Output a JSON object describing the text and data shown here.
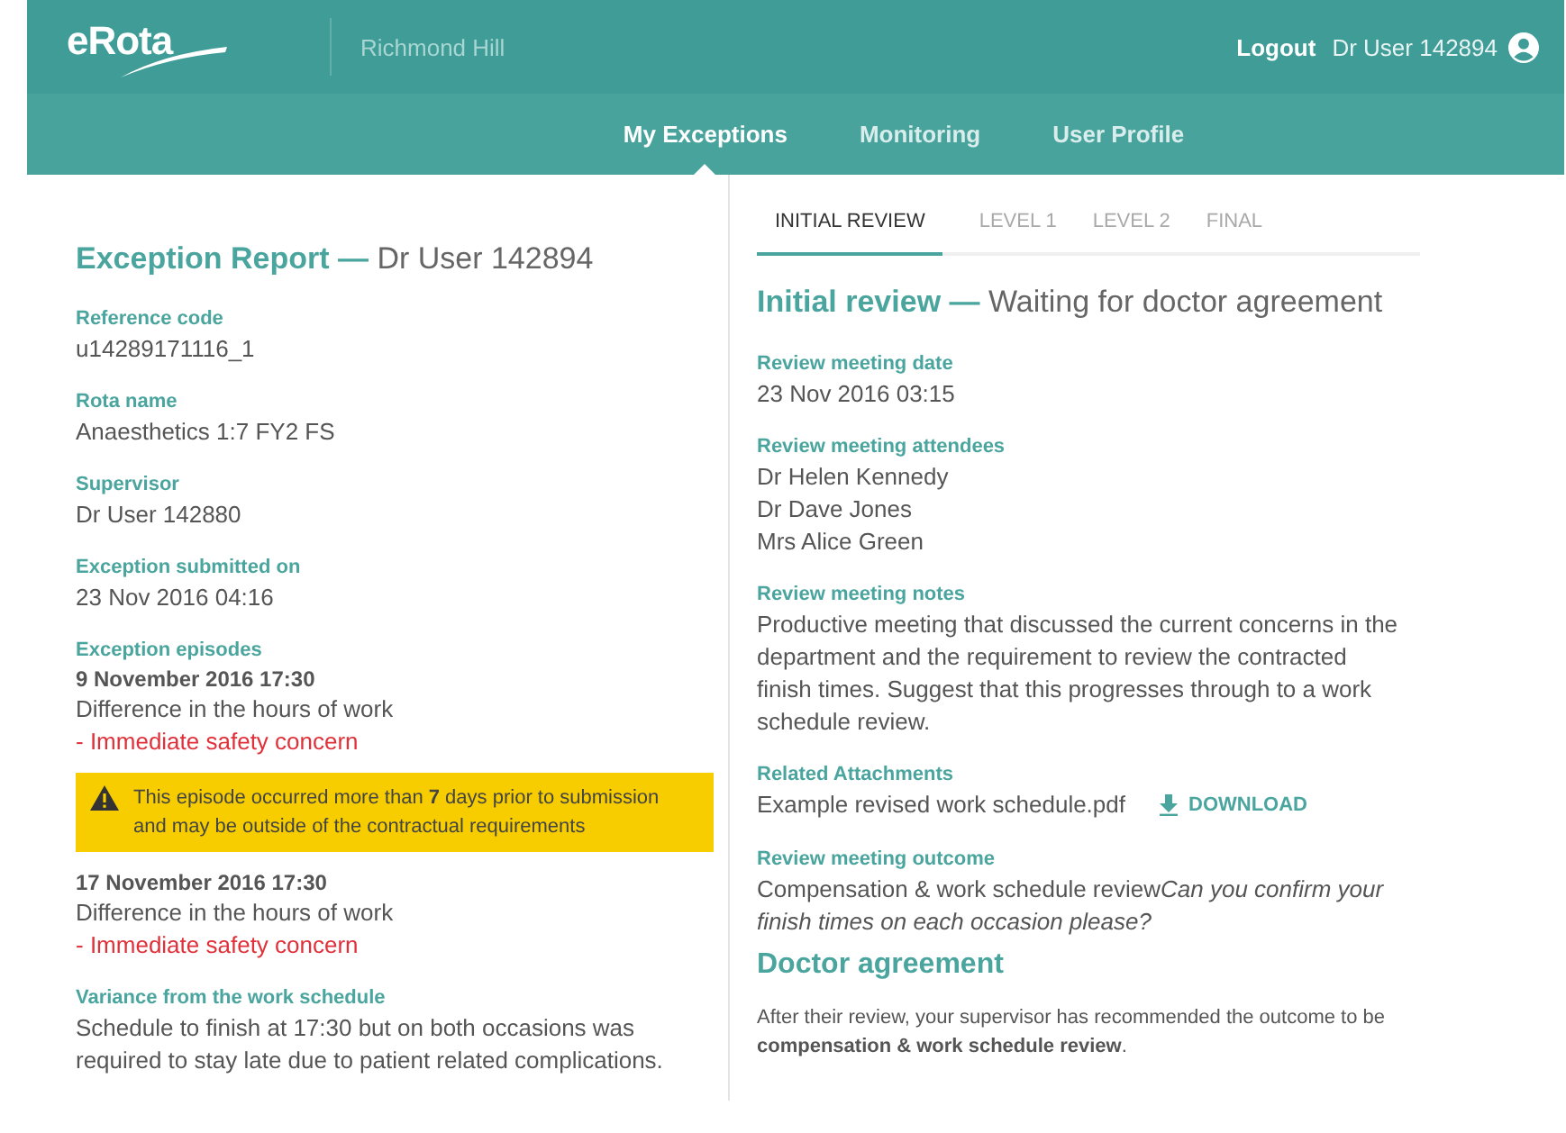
{
  "header": {
    "logo": "eRota",
    "site": "Richmond Hill",
    "logout": "Logout",
    "user": "Dr User 142894"
  },
  "nav": [
    {
      "label": "My Exceptions",
      "selected": true
    },
    {
      "label": "Monitoring",
      "selected": false
    },
    {
      "label": "User Profile",
      "selected": false
    }
  ],
  "report": {
    "title": "Exception Report —",
    "subtitle": "Dr User 142894",
    "fields": [
      {
        "label": "Reference code",
        "value": "u14289171116_1"
      },
      {
        "label": "Rota name",
        "value": "Anaesthetics 1:7 FY2 FS"
      },
      {
        "label": "Supervisor",
        "value": "Dr User 142880"
      },
      {
        "label": "Exception submitted on",
        "value": "23 Nov 2016 04:16"
      }
    ],
    "episodes_label": "Exception episodes",
    "episodes": [
      {
        "datetime": "9 November 2016  17:30",
        "type": "Difference in the hours of work",
        "concern": "- Immediate safety concern",
        "warning": "This episode occurred more than **7** days prior to submission and may be outside of the contractual requirements"
      },
      {
        "datetime": "17 November 2016  17:30",
        "type": "Difference in the hours of work",
        "concern": "- Immediate safety concern"
      }
    ],
    "variance": {
      "label": "Variance from the work schedule",
      "value": "Schedule to finish at 17:30 but on both occasions was required to stay late due to patient related complications."
    }
  },
  "review_tabs": [
    {
      "label": "INITIAL REVIEW",
      "selected": true,
      "disabled": false
    },
    {
      "label": "LEVEL 1",
      "selected": false,
      "disabled": true
    },
    {
      "label": "LEVEL 2",
      "selected": false,
      "disabled": true
    },
    {
      "label": "FINAL",
      "selected": false,
      "disabled": true
    }
  ],
  "review": {
    "title": "Initial review —",
    "status": "Waiting for doctor agreement",
    "fields": [
      {
        "label": "Review meeting date",
        "values": [
          "23 Nov 2016 03:15"
        ]
      },
      {
        "label": "Review meeting attendees",
        "values": [
          "Dr Helen Kennedy",
          "Dr Dave Jones",
          "Mrs Alice Green"
        ]
      },
      {
        "label": "Review meeting notes",
        "values": [
          "Productive meeting that discussed the current concerns in the department and the requirement to review the contracted finish times. Suggest that this progresses through to a work schedule review."
        ]
      }
    ],
    "attachments": {
      "label": "Related Attachments",
      "file": "Example revised work schedule.pdf",
      "action": "DOWNLOAD"
    },
    "outcome": {
      "label": "Review meeting outcome",
      "value": "Compensation & work schedule review",
      "comment": "Can you confirm your finish times on each occasion please?"
    }
  },
  "agreement": {
    "title": "Doctor agreement",
    "text": "After their review, your supervisor has recommended the outcome to be **compensation & work schedule review**."
  }
}
